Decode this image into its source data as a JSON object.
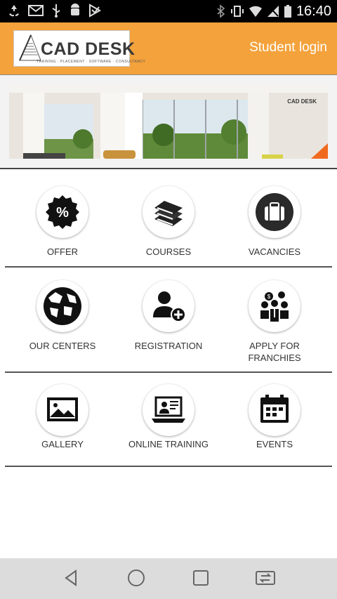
{
  "status_bar": {
    "time": "16:40",
    "left_icons": [
      "recycle-icon",
      "gmail-icon",
      "usb-icon",
      "android-debug-icon",
      "play-store-icon"
    ],
    "right_icons": [
      "bluetooth-icon",
      "vibrate-icon",
      "wifi-icon",
      "no-signal-icon",
      "battery-icon"
    ]
  },
  "header": {
    "logo_text": "CAD DESK",
    "logo_tagline": "TRAINING · PLACEMENT · SOFTWARE · CONSULTANCY",
    "student_login": "Student login",
    "color": "#f4a23b"
  },
  "banner": {
    "brand": "CAD DESK"
  },
  "menu": {
    "row1": [
      {
        "label": "OFFER",
        "icon": "percent-badge-icon"
      },
      {
        "label": "COURSES",
        "icon": "books-icon"
      },
      {
        "label": "VACANCIES",
        "icon": "briefcase-icon"
      }
    ],
    "row2": [
      {
        "label": "OUR CENTERS",
        "icon": "globe-icon"
      },
      {
        "label": "REGISTRATION",
        "icon": "add-user-icon"
      },
      {
        "label": "APPLY FOR\nFRANCHIES",
        "label_line1": "APPLY FOR",
        "label_line2": "FRANCHIES",
        "icon": "franchise-icon"
      }
    ],
    "row3": [
      {
        "label": "GALLERY",
        "icon": "image-icon"
      },
      {
        "label": "ONLINE TRAINING",
        "icon": "laptop-teacher-icon"
      },
      {
        "label": "EVENTS",
        "icon": "calendar-icon"
      }
    ]
  },
  "nav_bar": {
    "buttons": [
      "back-icon",
      "home-icon",
      "recents-icon",
      "switch-app-icon"
    ]
  }
}
